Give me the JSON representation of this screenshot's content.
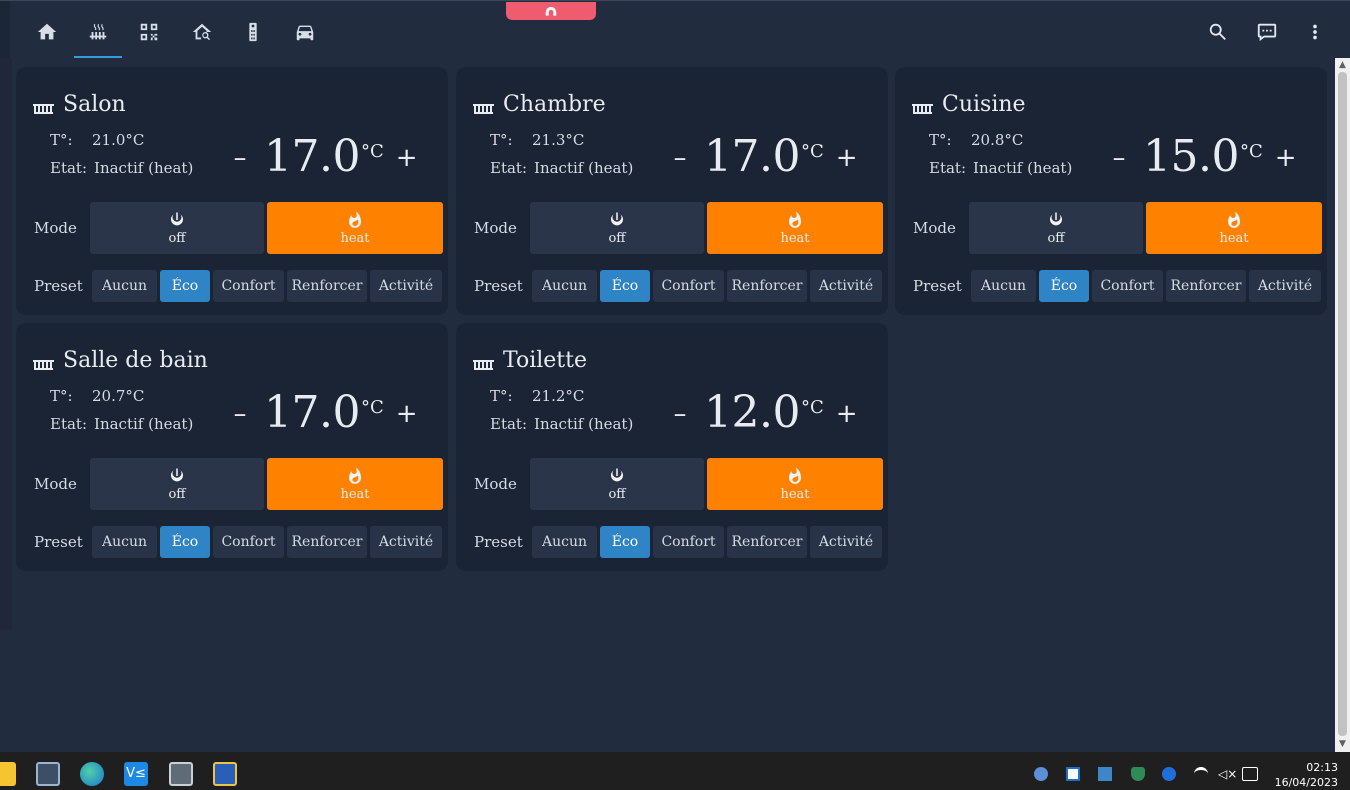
{
  "topbar": {
    "tabs": [
      {
        "name": "home-icon",
        "label": "Accueil"
      },
      {
        "name": "radiator-icon",
        "label": "Chauffage",
        "active": true
      },
      {
        "name": "qrcode-icon",
        "label": "Scanner"
      },
      {
        "name": "home-search-icon",
        "label": "Maison"
      },
      {
        "name": "remote-icon",
        "label": "Télécommande"
      },
      {
        "name": "car-icon",
        "label": "Voiture"
      }
    ],
    "actions": [
      "search-icon",
      "chat-icon",
      "menu-dots-icon"
    ]
  },
  "labels": {
    "temp_key": "T°:",
    "state_key": "Etat:",
    "mode": "Mode",
    "preset": "Preset",
    "minus": "–",
    "plus": "+",
    "unit": "°C",
    "off": "off",
    "heat": "heat"
  },
  "presets": [
    "Aucun",
    "Éco",
    "Confort",
    "Renforcer",
    "Activité"
  ],
  "active_preset": "Éco",
  "cards": [
    {
      "title": "Salon",
      "current": "21.0°C",
      "state": "Inactif (heat)",
      "target": "17.0",
      "mode": "heat"
    },
    {
      "title": "Chambre",
      "current": "21.3°C",
      "state": "Inactif (heat)",
      "target": "17.0",
      "mode": "heat"
    },
    {
      "title": "Cuisine",
      "current": "20.8°C",
      "state": "Inactif (heat)",
      "target": "15.0",
      "mode": "heat"
    },
    {
      "title": "Salle de bain",
      "current": "20.7°C",
      "state": "Inactif (heat)",
      "target": "17.0",
      "mode": "heat"
    },
    {
      "title": "Toilette",
      "current": "21.2°C",
      "state": "Inactif (heat)",
      "target": "12.0",
      "mode": "heat"
    }
  ],
  "colors": {
    "background": "#222c3f",
    "card": "#1b2434",
    "heat_accent": "#ff8100",
    "preset_active": "#2e84c4",
    "tab_indicator": "#3a9ad9"
  },
  "taskbar": {
    "apps": [
      "file-explorer-icon",
      "store-icon",
      "edge-icon",
      "vscode-icon",
      "calculator-icon",
      "network-app-icon"
    ],
    "tray": [
      "pen-icon",
      "dashlane-icon",
      "app-icon",
      "defender-icon",
      "bluetooth-icon",
      "wifi-icon",
      "volume-muted-icon",
      "battery-icon"
    ],
    "time": "02:13",
    "date": "16/04/2023"
  }
}
